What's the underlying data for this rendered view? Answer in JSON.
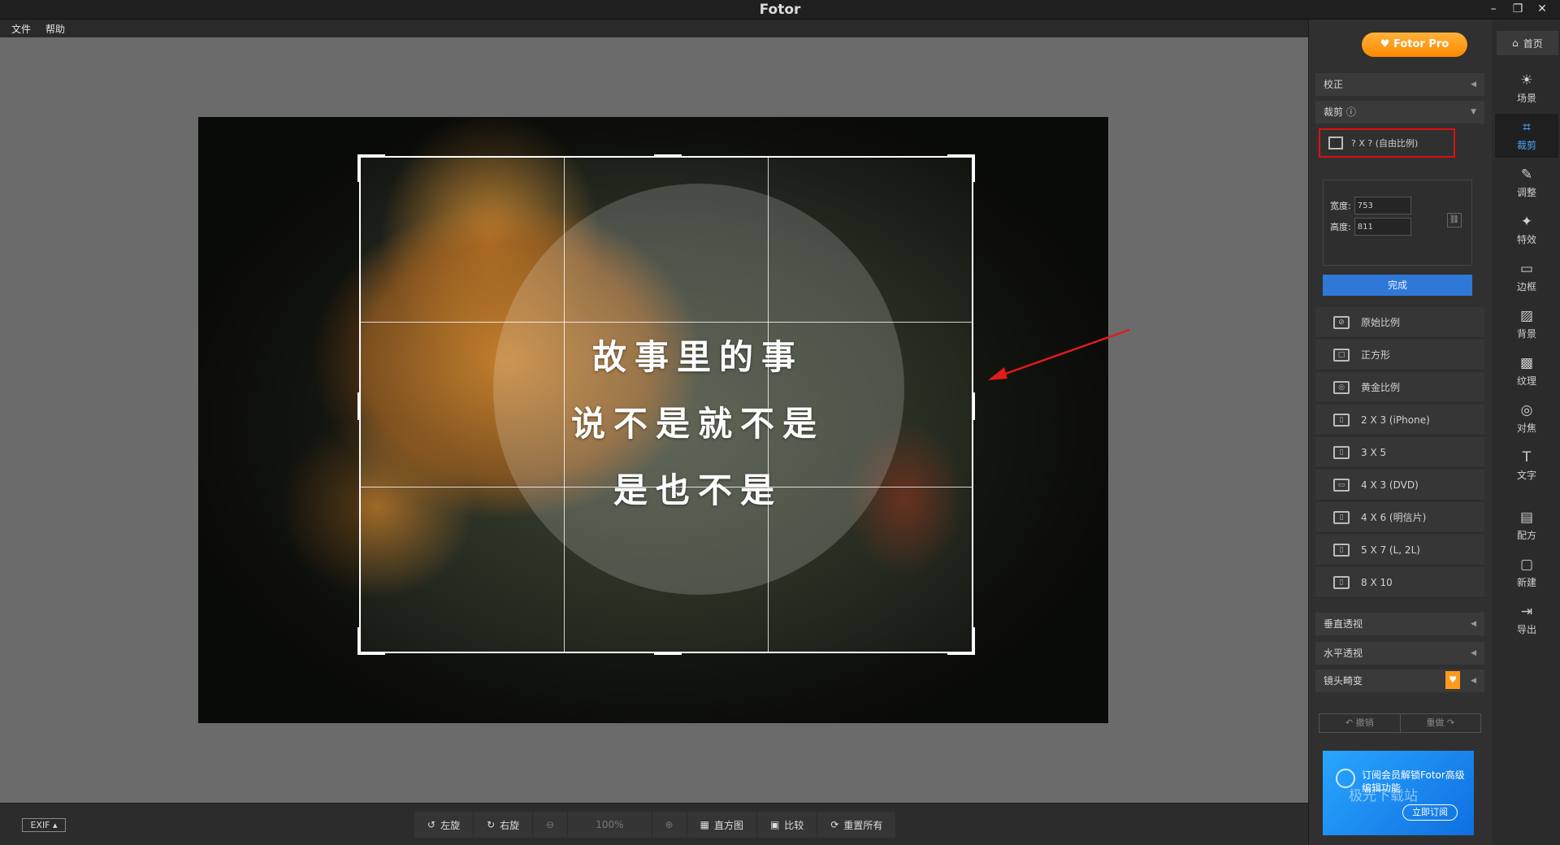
{
  "window": {
    "title": "Fotor",
    "controls": {
      "minimize": "–",
      "restore": "❐",
      "close": "✕"
    }
  },
  "menu": [
    "文件",
    "帮助"
  ],
  "image": {
    "quote_lines": [
      "故事里的事",
      "说不是就不是",
      "是也不是"
    ]
  },
  "bottom_bar": {
    "exif": "EXIF ▴",
    "tools": [
      {
        "id": "rotate-left",
        "icon": "↺",
        "label": "左旋"
      },
      {
        "id": "rotate-right",
        "icon": "↻",
        "label": "右旋"
      },
      {
        "id": "zoom-out",
        "icon": "⊖",
        "label": ""
      },
      {
        "id": "zoom",
        "icon": "",
        "label": "100%"
      },
      {
        "id": "zoom-in",
        "icon": "⊕",
        "label": ""
      },
      {
        "id": "histogram",
        "icon": "▦",
        "label": "直方图"
      },
      {
        "id": "compare",
        "icon": "▣",
        "label": "比较"
      },
      {
        "id": "reset-all",
        "icon": "⟳",
        "label": "重置所有"
      }
    ]
  },
  "panel": {
    "pro_button": "♥ Fotor Pro",
    "sections": {
      "correction": "校正",
      "crop": "裁剪 ⓘ",
      "vertical_perspective": "垂直透视",
      "horizontal_perspective": "水平透视",
      "lens_distortion": "镜头畸变"
    },
    "free_ratio": "? X ? (自由比例)",
    "width_label": "宽度:",
    "width_value": "753",
    "height_label": "高度:",
    "height_value": "811",
    "done_button": "完成",
    "presets": [
      {
        "icon": "⊘",
        "label": "原始比例"
      },
      {
        "icon": "□",
        "label": "正方形"
      },
      {
        "icon": "◎",
        "label": "黄金比例"
      },
      {
        "icon": "▯",
        "label": "2 X 3 (iPhone)"
      },
      {
        "icon": "▯",
        "label": "3 X 5"
      },
      {
        "icon": "▭",
        "label": "4 X 3 (DVD)"
      },
      {
        "icon": "▯",
        "label": "4 X 6 (明信片)"
      },
      {
        "icon": "▯",
        "label": "5 X 7 (L, 2L)"
      },
      {
        "icon": "▯",
        "label": "8 X 10"
      }
    ],
    "undo": "↶ 撤销",
    "redo": "重做 ↷",
    "ad_text": "订阅会员解锁Fotor高级编辑功能",
    "ad_button": "立即订阅"
  },
  "rail": {
    "home": "首页",
    "items": [
      {
        "id": "scene",
        "icon": "☀",
        "label": "场景"
      },
      {
        "id": "crop",
        "icon": "⌗",
        "label": "裁剪"
      },
      {
        "id": "adjust",
        "icon": "✎",
        "label": "调整"
      },
      {
        "id": "effects",
        "icon": "✦",
        "label": "特效"
      },
      {
        "id": "border",
        "icon": "▭",
        "label": "边框"
      },
      {
        "id": "background",
        "icon": "▨",
        "label": "背景"
      },
      {
        "id": "texture",
        "icon": "▩",
        "label": "纹理"
      },
      {
        "id": "focus",
        "icon": "◎",
        "label": "对焦"
      },
      {
        "id": "text",
        "icon": "T",
        "label": "文字"
      },
      {
        "id": "recipe",
        "icon": "▤",
        "label": "配方"
      },
      {
        "id": "new",
        "icon": "▢",
        "label": "新建"
      },
      {
        "id": "export",
        "icon": "⇥",
        "label": "导出"
      }
    ]
  },
  "watermark": "极光下载站"
}
